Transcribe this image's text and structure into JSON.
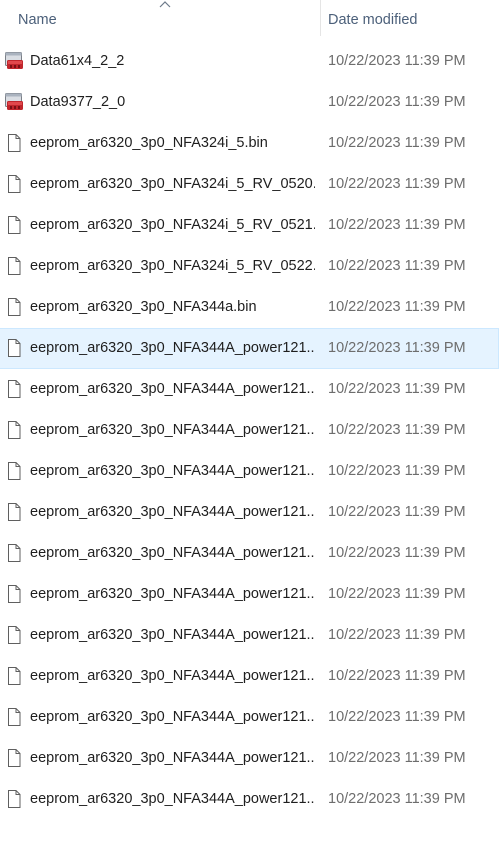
{
  "header": {
    "name_label": "Name",
    "date_label": "Date modified",
    "sort_icon": "chevron-up-icon"
  },
  "colors": {
    "header_text": "#4c607a",
    "hover_bg": "#e5f3ff",
    "hover_border": "#cce8ff",
    "date_text": "#6d6d6d"
  },
  "files": [
    {
      "name": "Data61x4_2_2",
      "date": "10/22/2023 11:39 PM",
      "icon": "data-file-icon"
    },
    {
      "name": "Data9377_2_0",
      "date": "10/22/2023 11:39 PM",
      "icon": "data-file-icon"
    },
    {
      "name": "eeprom_ar6320_3p0_NFA324i_5.bin",
      "date": "10/22/2023 11:39 PM",
      "icon": "document-icon"
    },
    {
      "name": "eeprom_ar6320_3p0_NFA324i_5_RV_0520...",
      "date": "10/22/2023 11:39 PM",
      "icon": "document-icon"
    },
    {
      "name": "eeprom_ar6320_3p0_NFA324i_5_RV_0521...",
      "date": "10/22/2023 11:39 PM",
      "icon": "document-icon"
    },
    {
      "name": "eeprom_ar6320_3p0_NFA324i_5_RV_0522...",
      "date": "10/22/2023 11:39 PM",
      "icon": "document-icon"
    },
    {
      "name": "eeprom_ar6320_3p0_NFA344a.bin",
      "date": "10/22/2023 11:39 PM",
      "icon": "document-icon"
    },
    {
      "name": "eeprom_ar6320_3p0_NFA344A_power121...",
      "date": "10/22/2023 11:39 PM",
      "icon": "document-icon",
      "hover": true
    },
    {
      "name": "eeprom_ar6320_3p0_NFA344A_power121...",
      "date": "10/22/2023 11:39 PM",
      "icon": "document-icon"
    },
    {
      "name": "eeprom_ar6320_3p0_NFA344A_power121...",
      "date": "10/22/2023 11:39 PM",
      "icon": "document-icon"
    },
    {
      "name": "eeprom_ar6320_3p0_NFA344A_power121...",
      "date": "10/22/2023 11:39 PM",
      "icon": "document-icon"
    },
    {
      "name": "eeprom_ar6320_3p0_NFA344A_power121...",
      "date": "10/22/2023 11:39 PM",
      "icon": "document-icon"
    },
    {
      "name": "eeprom_ar6320_3p0_NFA344A_power121...",
      "date": "10/22/2023 11:39 PM",
      "icon": "document-icon"
    },
    {
      "name": "eeprom_ar6320_3p0_NFA344A_power121...",
      "date": "10/22/2023 11:39 PM",
      "icon": "document-icon"
    },
    {
      "name": "eeprom_ar6320_3p0_NFA344A_power121...",
      "date": "10/22/2023 11:39 PM",
      "icon": "document-icon"
    },
    {
      "name": "eeprom_ar6320_3p0_NFA344A_power121...",
      "date": "10/22/2023 11:39 PM",
      "icon": "document-icon"
    },
    {
      "name": "eeprom_ar6320_3p0_NFA344A_power121...",
      "date": "10/22/2023 11:39 PM",
      "icon": "document-icon"
    },
    {
      "name": "eeprom_ar6320_3p0_NFA344A_power121...",
      "date": "10/22/2023 11:39 PM",
      "icon": "document-icon"
    },
    {
      "name": "eeprom_ar6320_3p0_NFA344A_power121...",
      "date": "10/22/2023 11:39 PM",
      "icon": "document-icon"
    }
  ]
}
